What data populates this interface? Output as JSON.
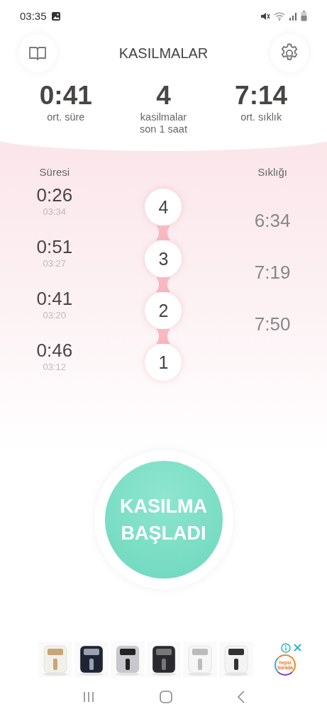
{
  "status_bar": {
    "time": "03:35"
  },
  "header": {
    "title": "KASILMALAR"
  },
  "stats": [
    {
      "value": "0:41",
      "label": "ort. süre"
    },
    {
      "value": "4",
      "label": "kasilmalar\nson 1 saat"
    },
    {
      "value": "7:14",
      "label": "ort. sıklık"
    }
  ],
  "history": {
    "duration_heading": "Süresi",
    "frequency_heading": "Sıklığı",
    "contractions": [
      {
        "number": "4",
        "duration": "0:26",
        "time": "03:34"
      },
      {
        "number": "3",
        "duration": "0:51",
        "time": "03:27"
      },
      {
        "number": "2",
        "duration": "0:41",
        "time": "03:20"
      },
      {
        "number": "1",
        "duration": "0:46",
        "time": "03:12"
      }
    ],
    "frequencies": [
      "6:34",
      "7:19",
      "7:50"
    ]
  },
  "start_button": {
    "label": "KASILMA\nBAŞLADI"
  },
  "ad": {
    "brand": "hepsi\nburada"
  }
}
